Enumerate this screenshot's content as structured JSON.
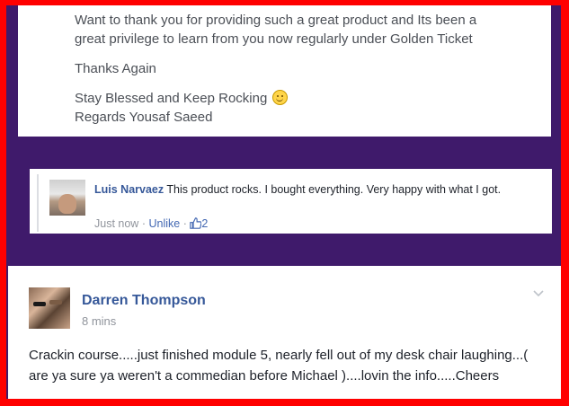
{
  "message": {
    "line1": "Want to thank you for providing such a great product and Its been a",
    "line2": "great privilege to learn from you now regularly under Golden Ticket",
    "thanks": "Thanks Again",
    "blessed": "Stay Blessed and Keep Rocking",
    "regards": "Regards Yousaf Saeed"
  },
  "comment": {
    "author": "Luis Narvaez",
    "text": "This product rocks. I bought everything. Very happy with what I got.",
    "time": "Just now",
    "separator": "·",
    "unlike": "Unlike",
    "likes": "2"
  },
  "post": {
    "author": "Darren Thompson",
    "time": "8 mins",
    "body": "Crackin course.....just finished module 5, nearly fell out of my desk chair laughing...( are ya sure ya weren't a commedian before Michael )....lovin the info.....Cheers"
  },
  "icons": {
    "emoji": "smile-emoji-icon",
    "like": "thumbs-up-icon",
    "menu": "chevron-down-icon"
  },
  "colors": {
    "border": "#ff0000",
    "background": "#3f1a6b",
    "link": "#365899"
  }
}
